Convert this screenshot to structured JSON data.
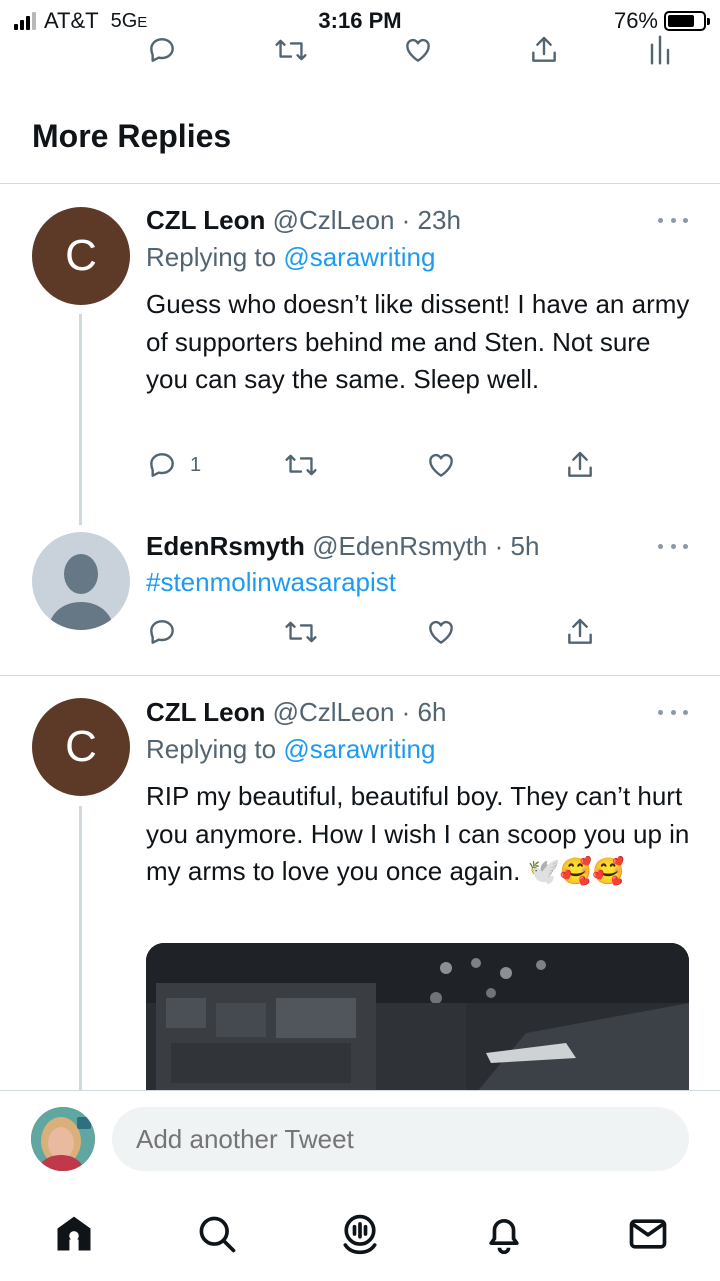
{
  "status_bar": {
    "carrier": "AT&T",
    "network": "5G",
    "network_suffix": "E",
    "time": "3:16 PM",
    "battery": "76%",
    "battery_level": 0.76
  },
  "section_title": "More Replies",
  "tweets": [
    {
      "name": "CZL Leon",
      "meta": "@CzlLeon · 23h",
      "avatar_letter": "C",
      "replying_label": "Replying to",
      "replying_handle": "@sarawriting",
      "text": "Guess who doesn’t like dissent! I have an army of supporters behind me and Sten. Not sure you can say the same. Sleep well.",
      "reply_count": "1"
    },
    {
      "name": "EdenRsmyth",
      "meta": "@EdenRsmyth · 5h",
      "hashtag": "#stenmolinwasarapist"
    },
    {
      "name": "CZL Leon",
      "meta": "@CzlLeon · 6h",
      "avatar_letter": "C",
      "replying_label": "Replying to",
      "replying_handle": "@sarawriting",
      "text": "RIP my beautiful, beautiful boy. They can’t hurt you anymore. How I wish I can scoop you up in my arms to love you once again. 🕊️🥰🥰"
    }
  ],
  "composer": {
    "placeholder": "Add another Tweet"
  },
  "icons": {
    "reply": "reply-icon",
    "retweet": "retweet-icon",
    "like": "like-icon",
    "share": "share-icon",
    "analytics": "analytics-icon",
    "home": "home-icon",
    "search": "search-icon",
    "spaces": "spaces-icon",
    "notifications": "notifications-icon",
    "messages": "messages-icon"
  },
  "colors": {
    "link": "#1d9bf0",
    "secondary_text": "#536471",
    "divider": "#cfd9de",
    "avatar_brown": "#5d3a28"
  }
}
